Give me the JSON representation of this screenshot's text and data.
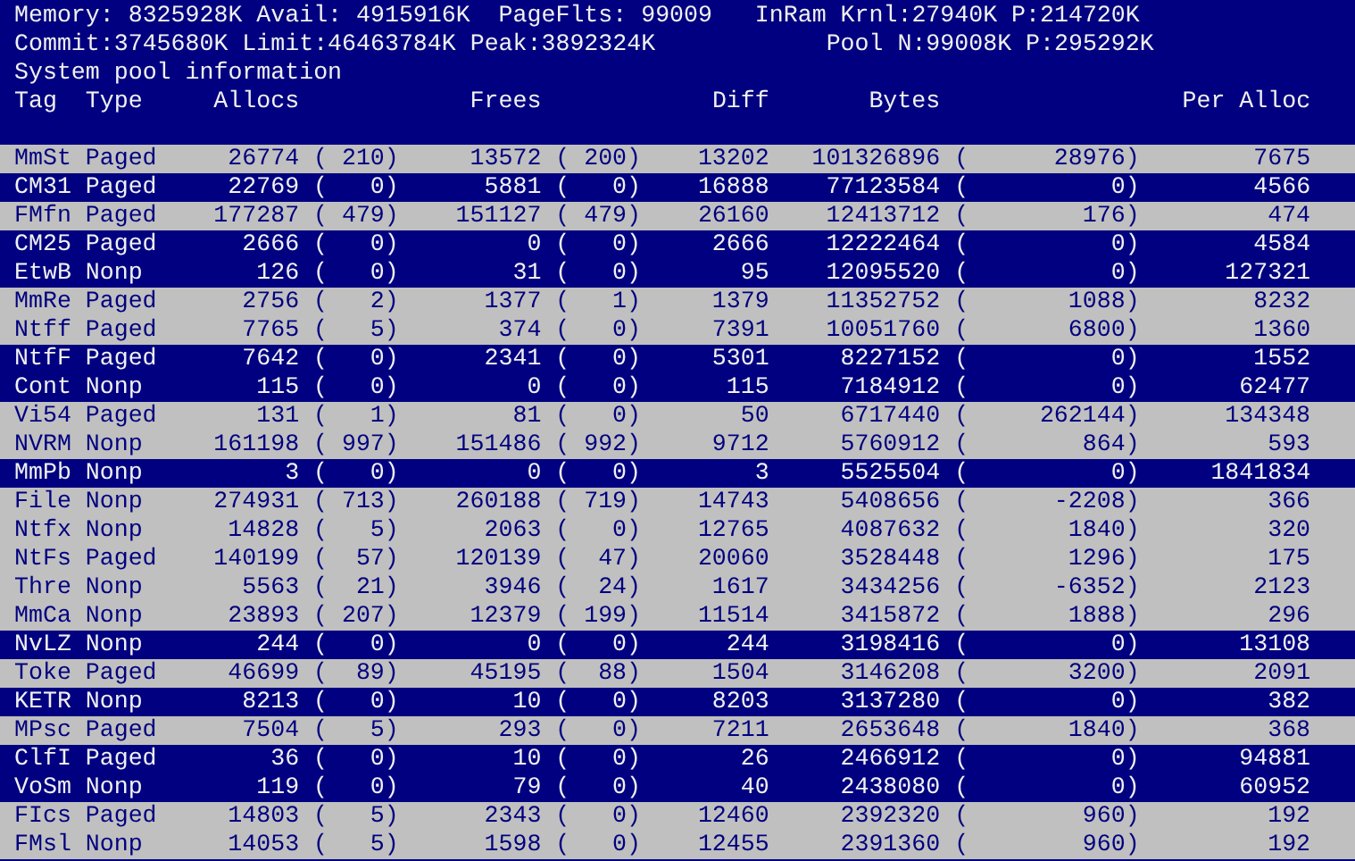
{
  "status_lines": [
    [
      "Memory: 8325928K Avail: 4915916K",
      "PageFlts: 99009",
      "InRam Krnl:27940K P:214720K"
    ],
    [
      "Commit:3745680K Limit:46463784K Peak:3892324K",
      "Pool N:99008K P:295292K"
    ]
  ],
  "title": "System pool information",
  "columns": [
    "Tag",
    "Type",
    "Allocs",
    "Frees",
    "Diff",
    "Bytes",
    "Per Alloc"
  ],
  "rows": [
    {
      "tag": "MmSt",
      "type": "Paged",
      "allocs": "26774",
      "allocs_change": "( 210)",
      "frees": "13572",
      "frees_change": "( 200)",
      "diff": "13202",
      "bytes": "101326896",
      "bytes_change": "(      28976)",
      "per_alloc": "7675",
      "highlighted": true
    },
    {
      "tag": "CM31",
      "type": "Paged",
      "allocs": "22769",
      "allocs_change": "(   0)",
      "frees": "5881",
      "frees_change": "(   0)",
      "diff": "16888",
      "bytes": "77123584",
      "bytes_change": "(          0)",
      "per_alloc": "4566",
      "highlighted": false
    },
    {
      "tag": "FMfn",
      "type": "Paged",
      "allocs": "177287",
      "allocs_change": "( 479)",
      "frees": "151127",
      "frees_change": "( 479)",
      "diff": "26160",
      "bytes": "12413712",
      "bytes_change": "(        176)",
      "per_alloc": "474",
      "highlighted": true
    },
    {
      "tag": "CM25",
      "type": "Paged",
      "allocs": "2666",
      "allocs_change": "(   0)",
      "frees": "0",
      "frees_change": "(   0)",
      "diff": "2666",
      "bytes": "12222464",
      "bytes_change": "(          0)",
      "per_alloc": "4584",
      "highlighted": false
    },
    {
      "tag": "EtwB",
      "type": "Nonp",
      "allocs": "126",
      "allocs_change": "(   0)",
      "frees": "31",
      "frees_change": "(   0)",
      "diff": "95",
      "bytes": "12095520",
      "bytes_change": "(          0)",
      "per_alloc": "127321",
      "highlighted": false
    },
    {
      "tag": "MmRe",
      "type": "Paged",
      "allocs": "2756",
      "allocs_change": "(   2)",
      "frees": "1377",
      "frees_change": "(   1)",
      "diff": "1379",
      "bytes": "11352752",
      "bytes_change": "(       1088)",
      "per_alloc": "8232",
      "highlighted": true
    },
    {
      "tag": "Ntff",
      "type": "Paged",
      "allocs": "7765",
      "allocs_change": "(   5)",
      "frees": "374",
      "frees_change": "(   0)",
      "diff": "7391",
      "bytes": "10051760",
      "bytes_change": "(       6800)",
      "per_alloc": "1360",
      "highlighted": true
    },
    {
      "tag": "NtfF",
      "type": "Paged",
      "allocs": "7642",
      "allocs_change": "(   0)",
      "frees": "2341",
      "frees_change": "(   0)",
      "diff": "5301",
      "bytes": "8227152",
      "bytes_change": "(          0)",
      "per_alloc": "1552",
      "highlighted": false
    },
    {
      "tag": "Cont",
      "type": "Nonp",
      "allocs": "115",
      "allocs_change": "(   0)",
      "frees": "0",
      "frees_change": "(   0)",
      "diff": "115",
      "bytes": "7184912",
      "bytes_change": "(          0)",
      "per_alloc": "62477",
      "highlighted": false
    },
    {
      "tag": "Vi54",
      "type": "Paged",
      "allocs": "131",
      "allocs_change": "(   1)",
      "frees": "81",
      "frees_change": "(   0)",
      "diff": "50",
      "bytes": "6717440",
      "bytes_change": "(     262144)",
      "per_alloc": "134348",
      "highlighted": true
    },
    {
      "tag": "NVRM",
      "type": "Nonp",
      "allocs": "161198",
      "allocs_change": "( 997)",
      "frees": "151486",
      "frees_change": "( 992)",
      "diff": "9712",
      "bytes": "5760912",
      "bytes_change": "(        864)",
      "per_alloc": "593",
      "highlighted": true
    },
    {
      "tag": "MmPb",
      "type": "Nonp",
      "allocs": "3",
      "allocs_change": "(   0)",
      "frees": "0",
      "frees_change": "(   0)",
      "diff": "3",
      "bytes": "5525504",
      "bytes_change": "(          0)",
      "per_alloc": "1841834",
      "highlighted": false
    },
    {
      "tag": "File",
      "type": "Nonp",
      "allocs": "274931",
      "allocs_change": "( 713)",
      "frees": "260188",
      "frees_change": "( 719)",
      "diff": "14743",
      "bytes": "5408656",
      "bytes_change": "(      -2208)",
      "per_alloc": "366",
      "highlighted": true
    },
    {
      "tag": "Ntfx",
      "type": "Nonp",
      "allocs": "14828",
      "allocs_change": "(   5)",
      "frees": "2063",
      "frees_change": "(   0)",
      "diff": "12765",
      "bytes": "4087632",
      "bytes_change": "(       1840)",
      "per_alloc": "320",
      "highlighted": true
    },
    {
      "tag": "NtFs",
      "type": "Paged",
      "allocs": "140199",
      "allocs_change": "(  57)",
      "frees": "120139",
      "frees_change": "(  47)",
      "diff": "20060",
      "bytes": "3528448",
      "bytes_change": "(       1296)",
      "per_alloc": "175",
      "highlighted": true
    },
    {
      "tag": "Thre",
      "type": "Nonp",
      "allocs": "5563",
      "allocs_change": "(  21)",
      "frees": "3946",
      "frees_change": "(  24)",
      "diff": "1617",
      "bytes": "3434256",
      "bytes_change": "(      -6352)",
      "per_alloc": "2123",
      "highlighted": true
    },
    {
      "tag": "MmCa",
      "type": "Nonp",
      "allocs": "23893",
      "allocs_change": "( 207)",
      "frees": "12379",
      "frees_change": "( 199)",
      "diff": "11514",
      "bytes": "3415872",
      "bytes_change": "(       1888)",
      "per_alloc": "296",
      "highlighted": true
    },
    {
      "tag": "NvLZ",
      "type": "Nonp",
      "allocs": "244",
      "allocs_change": "(   0)",
      "frees": "0",
      "frees_change": "(   0)",
      "diff": "244",
      "bytes": "3198416",
      "bytes_change": "(          0)",
      "per_alloc": "13108",
      "highlighted": false
    },
    {
      "tag": "Toke",
      "type": "Paged",
      "allocs": "46699",
      "allocs_change": "(  89)",
      "frees": "45195",
      "frees_change": "(  88)",
      "diff": "1504",
      "bytes": "3146208",
      "bytes_change": "(       3200)",
      "per_alloc": "2091",
      "highlighted": true
    },
    {
      "tag": "KETR",
      "type": "Nonp",
      "allocs": "8213",
      "allocs_change": "(   0)",
      "frees": "10",
      "frees_change": "(   0)",
      "diff": "8203",
      "bytes": "3137280",
      "bytes_change": "(          0)",
      "per_alloc": "382",
      "highlighted": false
    },
    {
      "tag": "MPsc",
      "type": "Paged",
      "allocs": "7504",
      "allocs_change": "(   5)",
      "frees": "293",
      "frees_change": "(   0)",
      "diff": "7211",
      "bytes": "2653648",
      "bytes_change": "(       1840)",
      "per_alloc": "368",
      "highlighted": true
    },
    {
      "tag": "ClfI",
      "type": "Paged",
      "allocs": "36",
      "allocs_change": "(   0)",
      "frees": "10",
      "frees_change": "(   0)",
      "diff": "26",
      "bytes": "2466912",
      "bytes_change": "(          0)",
      "per_alloc": "94881",
      "highlighted": false
    },
    {
      "tag": "VoSm",
      "type": "Nonp",
      "allocs": "119",
      "allocs_change": "(   0)",
      "frees": "79",
      "frees_change": "(   0)",
      "diff": "40",
      "bytes": "2438080",
      "bytes_change": "(          0)",
      "per_alloc": "60952",
      "highlighted": false
    },
    {
      "tag": "FIcs",
      "type": "Paged",
      "allocs": "14803",
      "allocs_change": "(   5)",
      "frees": "2343",
      "frees_change": "(   0)",
      "diff": "12460",
      "bytes": "2392320",
      "bytes_change": "(        960)",
      "per_alloc": "192",
      "highlighted": true
    },
    {
      "tag": "FMsl",
      "type": "Nonp",
      "allocs": "14053",
      "allocs_change": "(   5)",
      "frees": "1598",
      "frees_change": "(   0)",
      "diff": "12455",
      "bytes": "2391360",
      "bytes_change": "(        960)",
      "per_alloc": "192",
      "highlighted": true
    }
  ]
}
